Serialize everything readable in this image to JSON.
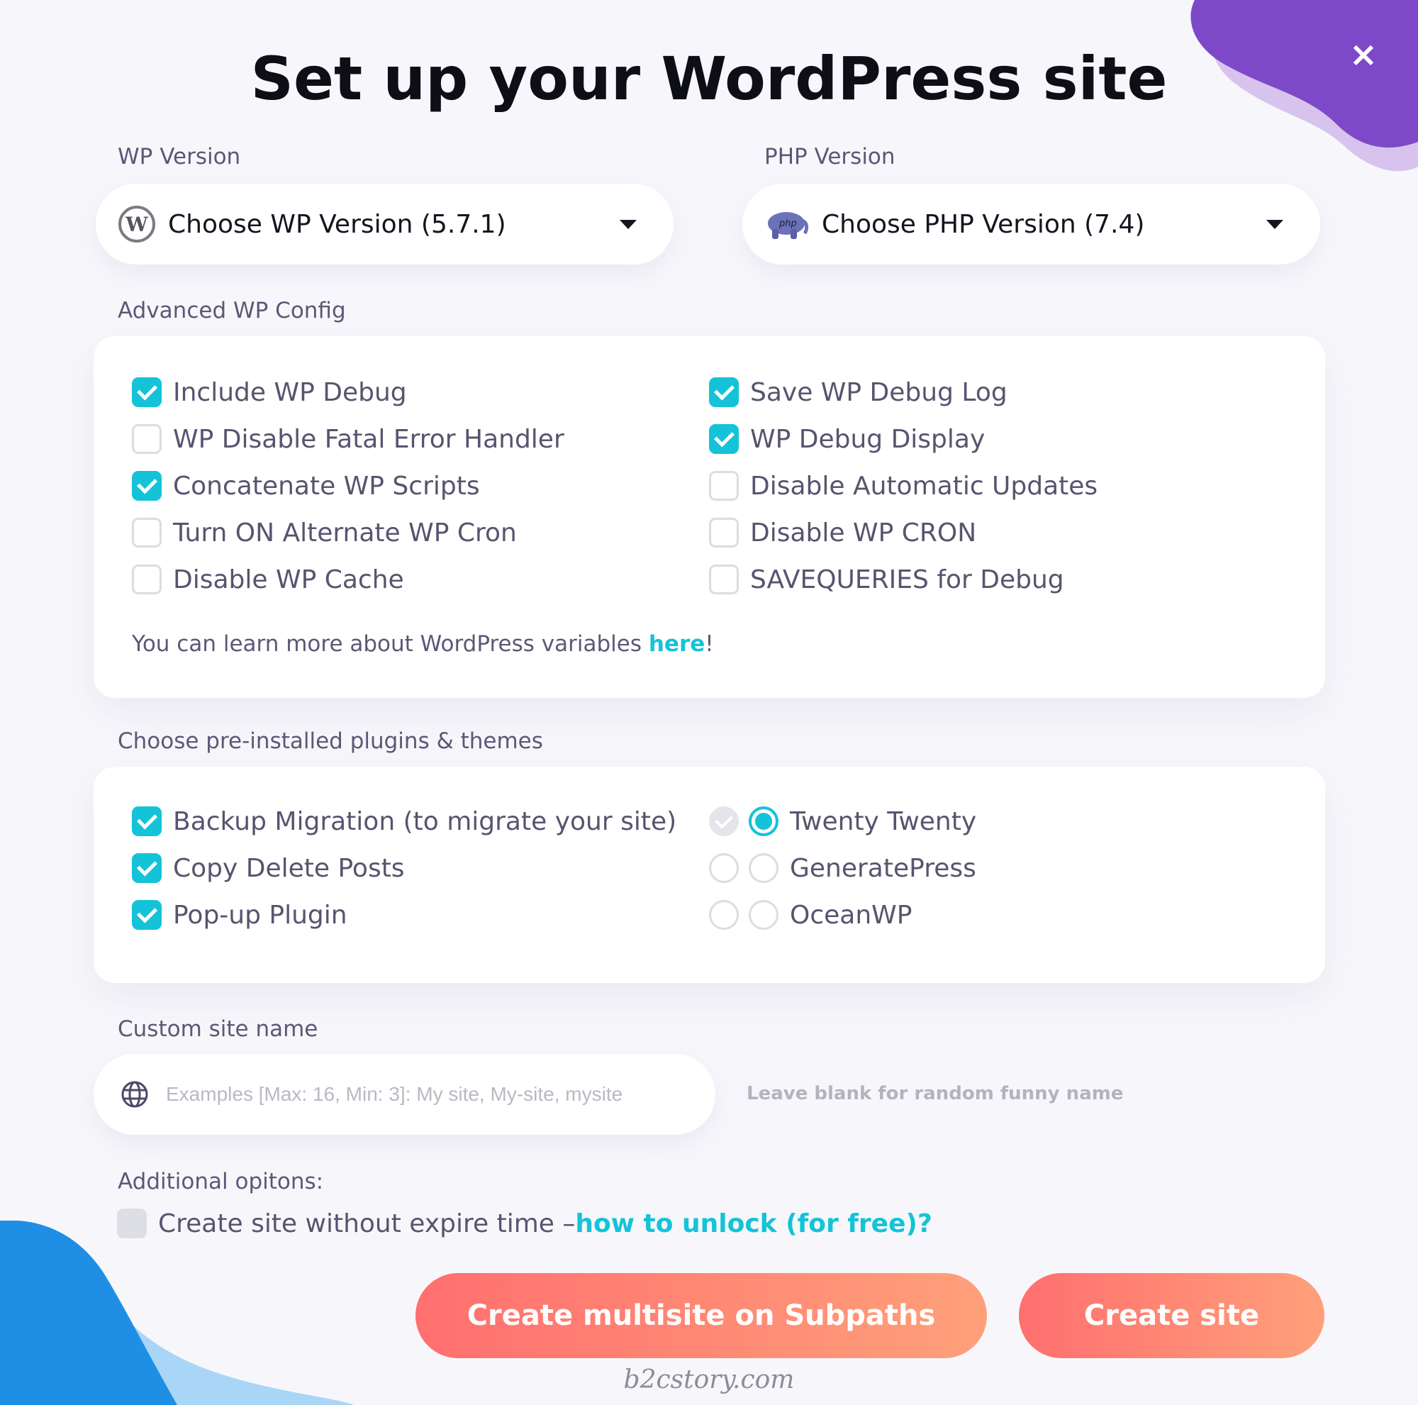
{
  "title": "Set up your WordPress site",
  "close_label": "×",
  "wp_version": {
    "label": "WP Version",
    "value": "Choose WP Version (5.7.1)"
  },
  "php_version": {
    "label": "PHP Version",
    "value": "Choose PHP Version (7.4)",
    "icon_text": "php"
  },
  "advanced": {
    "label": "Advanced WP Config",
    "options": [
      {
        "label": "Include WP Debug",
        "checked": true
      },
      {
        "label": "WP Disable Fatal Error Handler",
        "checked": false
      },
      {
        "label": "Concatenate WP Scripts",
        "checked": true
      },
      {
        "label": "Turn ON Alternate WP Cron",
        "checked": false
      },
      {
        "label": "Disable WP Cache",
        "checked": false
      },
      {
        "label": "Save WP Debug Log",
        "checked": true
      },
      {
        "label": "WP Debug Display",
        "checked": true
      },
      {
        "label": "Disable Automatic Updates",
        "checked": false
      },
      {
        "label": "Disable WP CRON",
        "checked": false
      },
      {
        "label": "SAVEQUERIES for Debug",
        "checked": false
      }
    ],
    "note_prefix": "You can learn more about WordPress variables ",
    "note_link": "here",
    "note_suffix": "!"
  },
  "plugins": {
    "label": "Choose pre-installed plugins & themes",
    "items": [
      {
        "label": "Backup Migration (to migrate your site)",
        "checked": true
      },
      {
        "label": "Copy Delete Posts",
        "checked": true
      },
      {
        "label": "Pop-up Plugin",
        "checked": true
      }
    ],
    "themes": [
      {
        "label": "Twenty Twenty",
        "selected": true
      },
      {
        "label": "GeneratePress",
        "selected": false
      },
      {
        "label": "OceanWP",
        "selected": false
      }
    ]
  },
  "site_name": {
    "label": "Custom site name",
    "placeholder": "Examples [Max: 16, Min: 3]: My site, My-site, mysite",
    "value": "",
    "hint": "Leave blank for random funny name"
  },
  "additional": {
    "label": "Additional opitons:",
    "option_text": "Create site without expire time – ",
    "link": "how to unlock (for free)?",
    "checked": false
  },
  "buttons": {
    "multisite": "Create multisite on Subpaths",
    "create": "Create site"
  },
  "watermark": "b2cstory.com",
  "colors": {
    "accent": "#14c3d8",
    "button_start": "#ff6f6f",
    "button_end": "#ffa07a",
    "blob_purple": "#7d49c9",
    "blob_blue": "#1f8fe6"
  }
}
